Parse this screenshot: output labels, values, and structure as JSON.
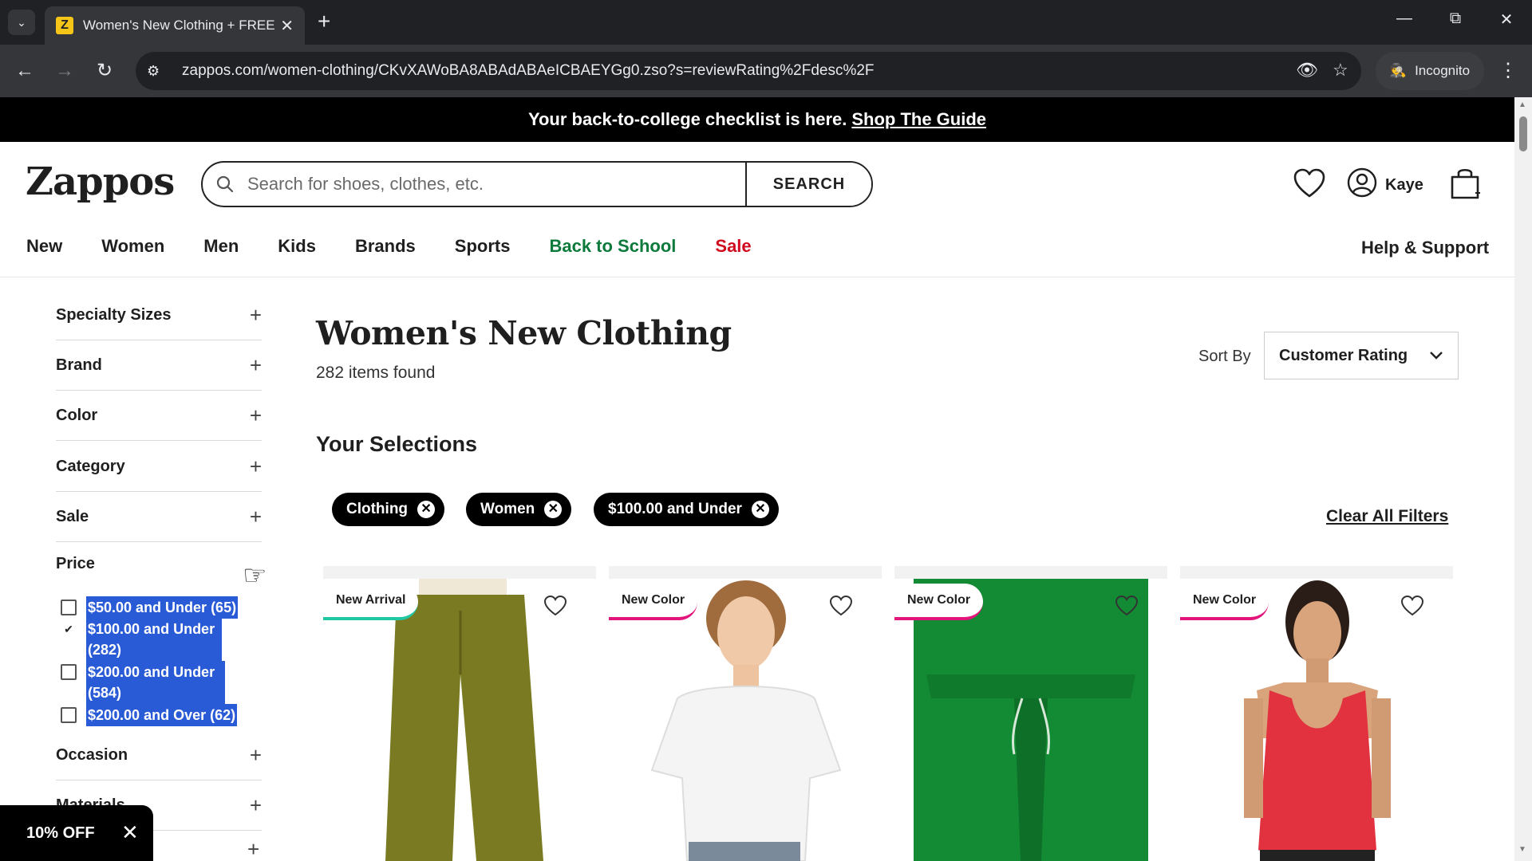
{
  "browser": {
    "tab_title": "Women's New Clothing + FREE",
    "favicon_letter": "Z",
    "url": "zappos.com/women-clothing/CKvXAWoBA8ABAdABAeICBAEYGg0.zso?s=reviewRating%2Fdesc%2F",
    "incognito_label": "Incognito"
  },
  "promo": {
    "text": "Your back-to-college checklist is here.",
    "link": "Shop The Guide"
  },
  "header": {
    "logo": "Zappos",
    "search_placeholder": "Search for shoes, clothes, etc.",
    "search_button": "SEARCH",
    "user_name": "Kaye"
  },
  "nav": {
    "items": [
      "New",
      "Women",
      "Men",
      "Kids",
      "Brands",
      "Sports",
      "Back to School",
      "Sale"
    ],
    "help": "Help & Support"
  },
  "sidebar": {
    "facets_top": [
      "Specialty Sizes",
      "Brand",
      "Color",
      "Category",
      "Sale"
    ],
    "price_label": "Price",
    "price_options": [
      {
        "label": "$50.00 and Under (65)",
        "checked": false
      },
      {
        "label": "$100.00 and Under (282)",
        "checked": true
      },
      {
        "label": "$200.00 and Under (584)",
        "checked": false
      },
      {
        "label": "$200.00 and Over (62)",
        "checked": false
      }
    ],
    "facets_bottom": [
      "Occasion",
      "Materials"
    ]
  },
  "discount_banner": {
    "label": "10% OFF"
  },
  "results": {
    "title": "Women's New Clothing",
    "count_text": "282 items found",
    "sort_label": "Sort By",
    "sort_value": "Customer Rating",
    "selections_heading": "Your Selections",
    "chips": [
      "Clothing",
      "Women",
      "$100.00 and Under"
    ],
    "clear_all": "Clear All Filters"
  },
  "products": [
    {
      "badge": "New Arrival",
      "badge_color": "#1fc7a3",
      "item_color": "#7a7a22"
    },
    {
      "badge": "New Color",
      "badge_color": "#e3147a",
      "item_color": "#f4f4f4"
    },
    {
      "badge": "New Color",
      "badge_color": "#e3147a",
      "item_color": "#138a34"
    },
    {
      "badge": "New Color",
      "badge_color": "#e3147a",
      "item_color": "#e2323f"
    }
  ],
  "icons": {
    "heart": "heart-icon",
    "user": "user-icon",
    "bag": "bag-icon",
    "search": "search-icon"
  }
}
